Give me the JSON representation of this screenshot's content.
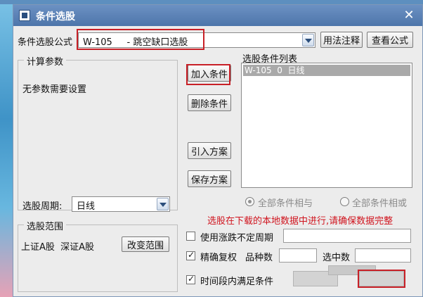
{
  "window": {
    "title": "条件选股"
  },
  "formula": {
    "label": "条件选股公式",
    "value": "W-105     - 跳空缺口选股",
    "help_button": "用法注释",
    "view_button": "查看公式"
  },
  "params": {
    "group_title": "计算参数",
    "none_text": "无参数需要设置"
  },
  "actions": {
    "add": "加入条件",
    "delete": "删除条件",
    "import": "引入方案",
    "save": "保存方案"
  },
  "conditions": {
    "title": "选股条件列表",
    "items": [
      "W-105  0  日线"
    ]
  },
  "period": {
    "label": "选股周期:",
    "value": "日线"
  },
  "logic": {
    "and_label": "全部条件相与",
    "or_label": "全部条件相或"
  },
  "warning": {
    "text": "选股在下载的本地数据中进行,请确保数据完整",
    "color": "#d0141e"
  },
  "scope": {
    "group_title": "选股范围",
    "value": "上证A股  深证A股",
    "change_button": "改变范围"
  },
  "options": {
    "uncertain_period": "使用涨跌不定周期",
    "exact_restore": "精确复权",
    "variety_count": "品种数",
    "selected_count": "选中数",
    "time_range": "时间段内满足条件"
  }
}
